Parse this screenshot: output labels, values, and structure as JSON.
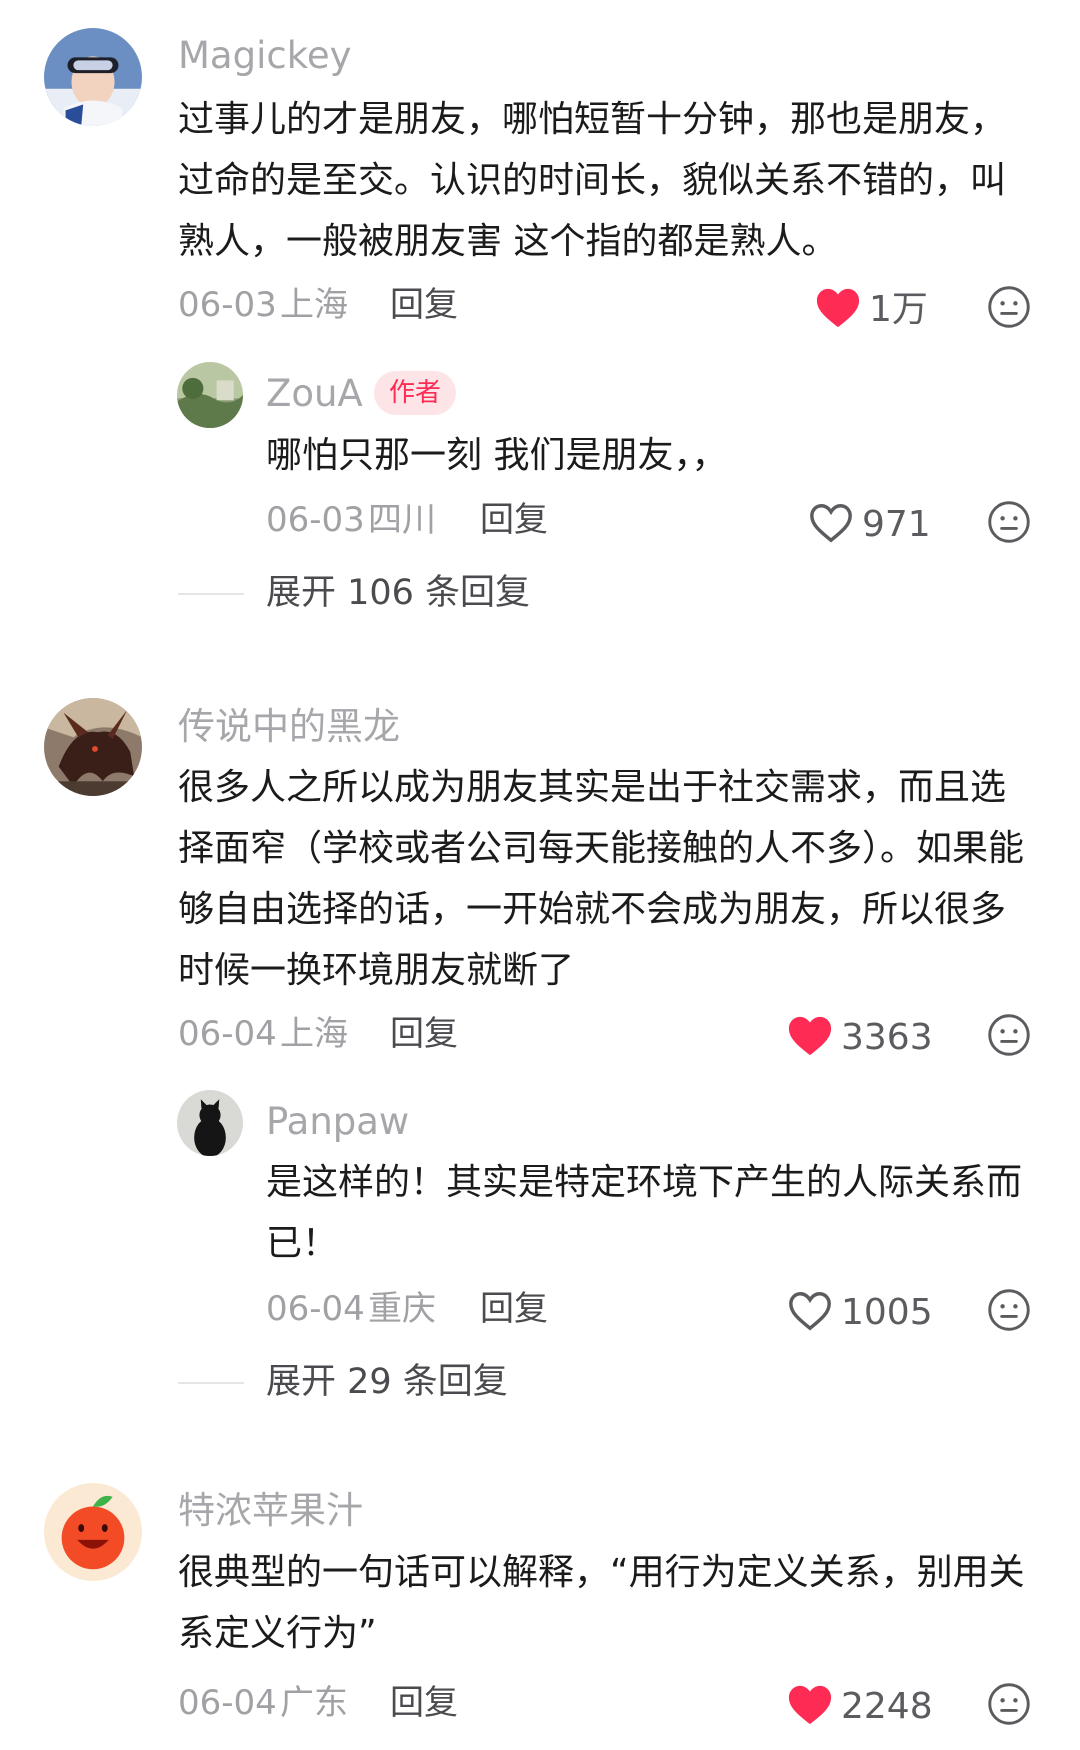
{
  "colors": {
    "accent_red": "#fe2c55",
    "name_gray": "#a7a7ab",
    "meta_gray": "#a1a1a5"
  },
  "comments": [
    {
      "user": "Magickey",
      "avatar_icon": "skier-goggles-avatar",
      "text": "过事儿的才是朋友，哪怕短暂十分钟，那也是朋友，过命的是至交。认识的时间长，貌似关系不错的，叫熟人，一般被朋友害 这个指的都是熟人。",
      "date": "06-03",
      "location": "上海",
      "reply_label": "回复",
      "likes": "1万",
      "liked": true,
      "replies": [
        {
          "user": "ZouA",
          "badge": "作者",
          "avatar_icon": "landscape-avatar",
          "text": "哪怕只那一刻 我们是朋友，，",
          "date": "06-03",
          "location": "四川",
          "reply_label": "回复",
          "likes": "971",
          "liked": false
        }
      ],
      "expand_label": "展开 106 条回复"
    },
    {
      "user": "传说中的黑龙",
      "avatar_icon": "black-dragon-avatar",
      "text": "很多人之所以成为朋友其实是出于社交需求，而且选择面窄（学校或者公司每天能接触的人不多）。如果能够自由选择的话，一开始就不会成为朋友，所以很多时候一换环境朋友就断了",
      "date": "06-04",
      "location": "上海",
      "reply_label": "回复",
      "likes": "3363",
      "liked": true,
      "replies": [
        {
          "user": "Panpaw",
          "avatar_icon": "black-cat-avatar",
          "text": "是这样的！其实是特定环境下产生的人际关系而已！",
          "date": "06-04",
          "location": "重庆",
          "reply_label": "回复",
          "likes": "1005",
          "liked": false
        }
      ],
      "expand_label": "展开 29 条回复"
    },
    {
      "user": "特浓苹果汁",
      "avatar_icon": "apple-avatar",
      "text": "很典型的一句话可以解释，“用行为定义关系，别用关系定义行为”",
      "date": "06-04",
      "location": "广东",
      "reply_label": "回复",
      "likes": "2248",
      "liked": true
    }
  ]
}
